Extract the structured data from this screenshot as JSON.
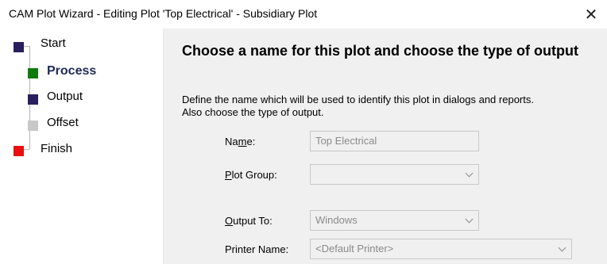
{
  "window": {
    "title": "CAM Plot Wizard - Editing Plot 'Top Electrical' - Subsidiary Plot",
    "close_glyph": "✕"
  },
  "steps": [
    {
      "label": "Start",
      "color": "#2a1f5c",
      "level": 0,
      "active": false
    },
    {
      "label": "Process",
      "color": "#0f7a0f",
      "level": 1,
      "active": true
    },
    {
      "label": "Output",
      "color": "#2a1f5c",
      "level": 1,
      "active": false
    },
    {
      "label": "Offset",
      "color": "#c8c8c8",
      "level": 1,
      "active": false
    },
    {
      "label": "Finish",
      "color": "#e81010",
      "level": 0,
      "active": false
    }
  ],
  "main": {
    "heading": "Choose a name for this plot and choose the type of output",
    "description_line1": "Define the name which will be used to identify this plot in dialogs and reports.",
    "description_line2": "Also choose the type of output.",
    "name": {
      "label_prefix": "Na",
      "label_accel": "m",
      "label_suffix": "e:",
      "value": "Top Electrical"
    },
    "plot_group": {
      "label_accel": "P",
      "label_rest": "lot Group:",
      "value": ""
    },
    "output_to": {
      "label_accel": "O",
      "label_rest": "utput To:",
      "value": "Windows"
    },
    "printer_name": {
      "label": "Printer Name:",
      "value": "<Default Printer>"
    }
  }
}
